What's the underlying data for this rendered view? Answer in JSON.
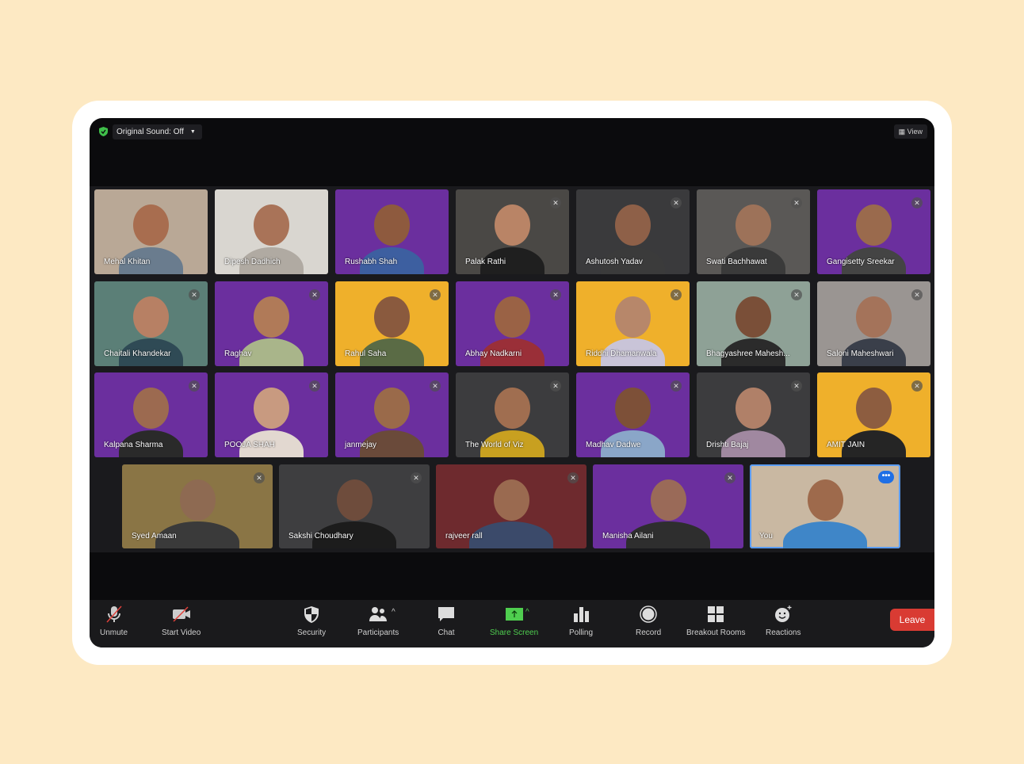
{
  "topbar": {
    "original_sound": "Original Sound: Off",
    "view_label": "View",
    "security_color": "#3fbf4a"
  },
  "tiles": [
    {
      "name": "Mehal Khitan",
      "bg": "#b9a896",
      "skin": "#a86d4f",
      "shirt": "#6a7c8e",
      "muted": false
    },
    {
      "name": "Dipesh Dadhich",
      "bg": "#d9d6d0",
      "skin": "#a97358",
      "shirt": "#b0aaa2",
      "muted": false
    },
    {
      "name": "Rushabh Shah",
      "bg": "#6b2f9e",
      "skin": "#8e5a3e",
      "shirt": "#3d5fa0",
      "muted": false
    },
    {
      "name": "Palak Rathi",
      "bg": "#4a4845",
      "skin": "#b98466",
      "shirt": "#1f1f1f",
      "muted": true
    },
    {
      "name": "Ashutosh Yadav",
      "bg": "#3a3a3c",
      "skin": "#8e6048",
      "shirt": "#3b3b3b",
      "muted": true
    },
    {
      "name": "Swati Bachhawat",
      "bg": "#5a5856",
      "skin": "#9d7259",
      "shirt": "#3a3a3a",
      "muted": true
    },
    {
      "name": "Gangisetty Sreekar",
      "bg": "#6b2f9e",
      "skin": "#9a6a4d",
      "shirt": "#444",
      "muted": true
    },
    {
      "name": "Chaitali Khandekar",
      "bg": "#5b7f77",
      "skin": "#b78064",
      "shirt": "#2f4a55",
      "muted": true
    },
    {
      "name": "Raghav",
      "bg": "#6b2f9e",
      "skin": "#b07a58",
      "shirt": "#a9b58a",
      "muted": true
    },
    {
      "name": "Rahul Saha",
      "bg": "#efb02b",
      "skin": "#8a5a3e",
      "shirt": "#5a6b45",
      "muted": true
    },
    {
      "name": "Abhay Nadkarni",
      "bg": "#6b2f9e",
      "skin": "#9a6245",
      "shirt": "#9a2f38",
      "muted": true
    },
    {
      "name": "Riddhi Dhamanwala",
      "bg": "#efb02b",
      "skin": "#b7876a",
      "shirt": "#c9c4d8",
      "muted": true
    },
    {
      "name": "Bhagyashree Mahesh...",
      "bg": "#8ea196",
      "skin": "#7a4f38",
      "shirt": "#2b2b2b",
      "muted": true
    },
    {
      "name": "Saloni Maheshwari",
      "bg": "#9a9592",
      "skin": "#a4735a",
      "shirt": "#3a3f4a",
      "muted": true
    },
    {
      "name": "Kalpana Sharma",
      "bg": "#6b2f9e",
      "skin": "#9c6a50",
      "shirt": "#2a2a2a",
      "muted": true
    },
    {
      "name": "POOJA SHAH",
      "bg": "#6b2f9e",
      "skin": "#c89a80",
      "shirt": "#e2d8d0",
      "muted": true
    },
    {
      "name": "janmejay",
      "bg": "#6b2f9e",
      "skin": "#9a6a4a",
      "shirt": "#6a4a3a",
      "muted": true
    },
    {
      "name": "The World of Viz",
      "bg": "#3c3c3e",
      "skin": "#a06e50",
      "shirt": "#c8a020",
      "muted": true
    },
    {
      "name": "Madhav Dadwe",
      "bg": "#6b2f9e",
      "skin": "#7d5038",
      "shirt": "#8aa6c8",
      "muted": true
    },
    {
      "name": "Drishti Bajaj",
      "bg": "#3c3c3e",
      "skin": "#b08068",
      "shirt": "#a088a0",
      "muted": true
    },
    {
      "name": "AMIT JAIN",
      "bg": "#efb02b",
      "skin": "#8d5d40",
      "shirt": "#252525",
      "muted": true
    },
    {
      "name": "Syed Amaan",
      "bg": "#8a7545",
      "skin": "#8e6a52",
      "shirt": "#3a3a3a",
      "muted": true
    },
    {
      "name": "Sakshi Choudhary",
      "bg": "#3e3e40",
      "skin": "#6e4c3c",
      "shirt": "#1c1c1c",
      "muted": true
    },
    {
      "name": "rajveer rall",
      "bg": "#6e2a2e",
      "skin": "#9a6a50",
      "shirt": "#3b4a6a",
      "muted": true
    },
    {
      "name": "Manisha Ailani",
      "bg": "#6b2f9e",
      "skin": "#9a6a58",
      "shirt": "#2e2e2e",
      "muted": true
    },
    {
      "name": "You",
      "bg": "#c9b8a2",
      "skin": "#9e6a4c",
      "shirt": "#3f86c8",
      "muted": false,
      "me": true
    }
  ],
  "toolbar": {
    "unmute": "Unmute",
    "start_video": "Start Video",
    "security": "Security",
    "participants": "Participants",
    "chat": "Chat",
    "share_screen": "Share Screen",
    "polling": "Polling",
    "record": "Record",
    "breakout_rooms": "Breakout Rooms",
    "reactions": "Reactions",
    "leave": "Leave",
    "leave_color": "#d93b33",
    "share_color": "#4fce4f"
  }
}
